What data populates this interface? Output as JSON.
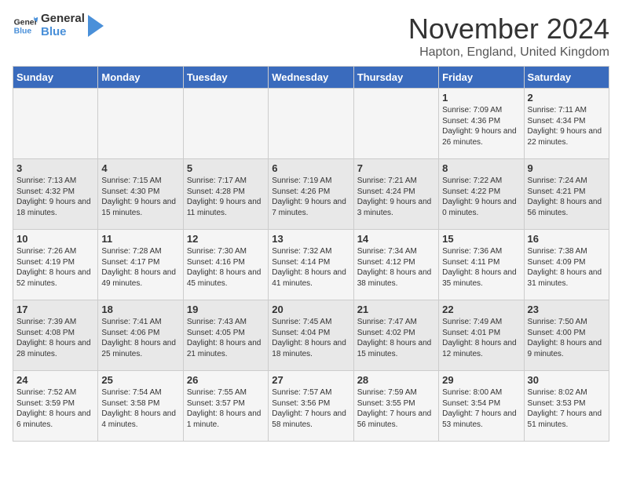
{
  "header": {
    "logo_general": "General",
    "logo_blue": "Blue",
    "month": "November 2024",
    "location": "Hapton, England, United Kingdom"
  },
  "weekdays": [
    "Sunday",
    "Monday",
    "Tuesday",
    "Wednesday",
    "Thursday",
    "Friday",
    "Saturday"
  ],
  "weeks": [
    [
      {
        "day": "",
        "info": ""
      },
      {
        "day": "",
        "info": ""
      },
      {
        "day": "",
        "info": ""
      },
      {
        "day": "",
        "info": ""
      },
      {
        "day": "",
        "info": ""
      },
      {
        "day": "1",
        "info": "Sunrise: 7:09 AM\nSunset: 4:36 PM\nDaylight: 9 hours and 26 minutes."
      },
      {
        "day": "2",
        "info": "Sunrise: 7:11 AM\nSunset: 4:34 PM\nDaylight: 9 hours and 22 minutes."
      }
    ],
    [
      {
        "day": "3",
        "info": "Sunrise: 7:13 AM\nSunset: 4:32 PM\nDaylight: 9 hours and 18 minutes."
      },
      {
        "day": "4",
        "info": "Sunrise: 7:15 AM\nSunset: 4:30 PM\nDaylight: 9 hours and 15 minutes."
      },
      {
        "day": "5",
        "info": "Sunrise: 7:17 AM\nSunset: 4:28 PM\nDaylight: 9 hours and 11 minutes."
      },
      {
        "day": "6",
        "info": "Sunrise: 7:19 AM\nSunset: 4:26 PM\nDaylight: 9 hours and 7 minutes."
      },
      {
        "day": "7",
        "info": "Sunrise: 7:21 AM\nSunset: 4:24 PM\nDaylight: 9 hours and 3 minutes."
      },
      {
        "day": "8",
        "info": "Sunrise: 7:22 AM\nSunset: 4:22 PM\nDaylight: 9 hours and 0 minutes."
      },
      {
        "day": "9",
        "info": "Sunrise: 7:24 AM\nSunset: 4:21 PM\nDaylight: 8 hours and 56 minutes."
      }
    ],
    [
      {
        "day": "10",
        "info": "Sunrise: 7:26 AM\nSunset: 4:19 PM\nDaylight: 8 hours and 52 minutes."
      },
      {
        "day": "11",
        "info": "Sunrise: 7:28 AM\nSunset: 4:17 PM\nDaylight: 8 hours and 49 minutes."
      },
      {
        "day": "12",
        "info": "Sunrise: 7:30 AM\nSunset: 4:16 PM\nDaylight: 8 hours and 45 minutes."
      },
      {
        "day": "13",
        "info": "Sunrise: 7:32 AM\nSunset: 4:14 PM\nDaylight: 8 hours and 41 minutes."
      },
      {
        "day": "14",
        "info": "Sunrise: 7:34 AM\nSunset: 4:12 PM\nDaylight: 8 hours and 38 minutes."
      },
      {
        "day": "15",
        "info": "Sunrise: 7:36 AM\nSunset: 4:11 PM\nDaylight: 8 hours and 35 minutes."
      },
      {
        "day": "16",
        "info": "Sunrise: 7:38 AM\nSunset: 4:09 PM\nDaylight: 8 hours and 31 minutes."
      }
    ],
    [
      {
        "day": "17",
        "info": "Sunrise: 7:39 AM\nSunset: 4:08 PM\nDaylight: 8 hours and 28 minutes."
      },
      {
        "day": "18",
        "info": "Sunrise: 7:41 AM\nSunset: 4:06 PM\nDaylight: 8 hours and 25 minutes."
      },
      {
        "day": "19",
        "info": "Sunrise: 7:43 AM\nSunset: 4:05 PM\nDaylight: 8 hours and 21 minutes."
      },
      {
        "day": "20",
        "info": "Sunrise: 7:45 AM\nSunset: 4:04 PM\nDaylight: 8 hours and 18 minutes."
      },
      {
        "day": "21",
        "info": "Sunrise: 7:47 AM\nSunset: 4:02 PM\nDaylight: 8 hours and 15 minutes."
      },
      {
        "day": "22",
        "info": "Sunrise: 7:49 AM\nSunset: 4:01 PM\nDaylight: 8 hours and 12 minutes."
      },
      {
        "day": "23",
        "info": "Sunrise: 7:50 AM\nSunset: 4:00 PM\nDaylight: 8 hours and 9 minutes."
      }
    ],
    [
      {
        "day": "24",
        "info": "Sunrise: 7:52 AM\nSunset: 3:59 PM\nDaylight: 8 hours and 6 minutes."
      },
      {
        "day": "25",
        "info": "Sunrise: 7:54 AM\nSunset: 3:58 PM\nDaylight: 8 hours and 4 minutes."
      },
      {
        "day": "26",
        "info": "Sunrise: 7:55 AM\nSunset: 3:57 PM\nDaylight: 8 hours and 1 minute."
      },
      {
        "day": "27",
        "info": "Sunrise: 7:57 AM\nSunset: 3:56 PM\nDaylight: 7 hours and 58 minutes."
      },
      {
        "day": "28",
        "info": "Sunrise: 7:59 AM\nSunset: 3:55 PM\nDaylight: 7 hours and 56 minutes."
      },
      {
        "day": "29",
        "info": "Sunrise: 8:00 AM\nSunset: 3:54 PM\nDaylight: 7 hours and 53 minutes."
      },
      {
        "day": "30",
        "info": "Sunrise: 8:02 AM\nSunset: 3:53 PM\nDaylight: 7 hours and 51 minutes."
      }
    ]
  ]
}
